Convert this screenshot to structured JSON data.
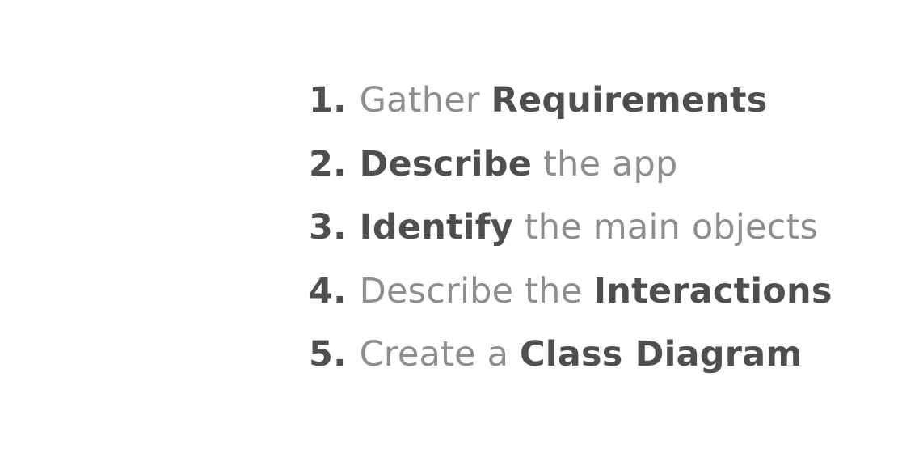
{
  "steps": [
    {
      "number": "1.",
      "segments": [
        {
          "text": "Gather ",
          "style": "light"
        },
        {
          "text": "Requirements",
          "style": "bold"
        }
      ]
    },
    {
      "number": "2.",
      "segments": [
        {
          "text": "Describe",
          "style": "bold"
        },
        {
          "text": " the app",
          "style": "light"
        }
      ]
    },
    {
      "number": "3.",
      "segments": [
        {
          "text": "Identify",
          "style": "bold"
        },
        {
          "text": " the main objects",
          "style": "light"
        }
      ]
    },
    {
      "number": "4.",
      "segments": [
        {
          "text": "Describe the ",
          "style": "light"
        },
        {
          "text": "Interactions",
          "style": "bold"
        }
      ]
    },
    {
      "number": "5.",
      "segments": [
        {
          "text": "Create a ",
          "style": "light"
        },
        {
          "text": "Class Diagram",
          "style": "bold"
        }
      ]
    }
  ],
  "colors": {
    "bold_text": "#4f4f4f",
    "light_text": "#8e8e8e",
    "background": "#ffffff"
  }
}
